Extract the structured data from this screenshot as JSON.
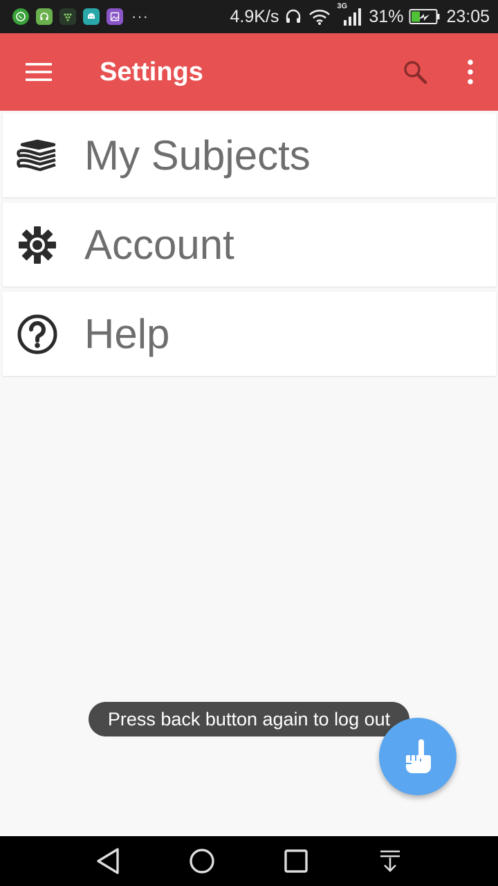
{
  "status_bar": {
    "network_speed": "4.9K/s",
    "network_type": "3G",
    "battery_percent": "31%",
    "time": "23:05",
    "notification_icons": [
      "whatsapp-icon",
      "headset-app-icon",
      "blackberry-icon",
      "android-app-icon",
      "gallery-icon"
    ],
    "more_indicator": "···"
  },
  "app_bar": {
    "title": "Settings",
    "color": "#e85151"
  },
  "settings_items": [
    {
      "label": "My Subjects",
      "icon": "books-icon"
    },
    {
      "label": "Account",
      "icon": "gear-icon"
    },
    {
      "label": "Help",
      "icon": "help-circle-icon"
    }
  ],
  "toast": {
    "message": "Press back button again to log out"
  },
  "fab": {
    "icon": "pointing-hand-icon",
    "color": "#5aa6f0"
  },
  "nav_bar": {
    "buttons": [
      "back-icon",
      "home-icon",
      "recents-icon",
      "notification-pulldown-icon"
    ]
  }
}
